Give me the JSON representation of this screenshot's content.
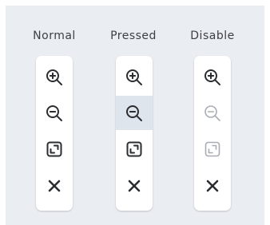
{
  "columns": [
    {
      "label": "Normal",
      "state": "normal",
      "tools": [
        {
          "name": "zoom-in",
          "icon": "zoom-in-icon",
          "pressed": false,
          "disabled": false
        },
        {
          "name": "zoom-out",
          "icon": "zoom-out-icon",
          "pressed": false,
          "disabled": false
        },
        {
          "name": "fit-to-screen",
          "icon": "fit-to-screen-icon",
          "pressed": false,
          "disabled": false
        },
        {
          "name": "close",
          "icon": "close-icon",
          "pressed": false,
          "disabled": false
        }
      ]
    },
    {
      "label": "Pressed",
      "state": "pressed",
      "tools": [
        {
          "name": "zoom-in",
          "icon": "zoom-in-icon",
          "pressed": false,
          "disabled": false
        },
        {
          "name": "zoom-out",
          "icon": "zoom-out-icon",
          "pressed": true,
          "disabled": false
        },
        {
          "name": "fit-to-screen",
          "icon": "fit-to-screen-icon",
          "pressed": false,
          "disabled": false
        },
        {
          "name": "close",
          "icon": "close-icon",
          "pressed": false,
          "disabled": false
        }
      ]
    },
    {
      "label": "Disable",
      "state": "disabled",
      "tools": [
        {
          "name": "zoom-in",
          "icon": "zoom-in-icon",
          "pressed": false,
          "disabled": false
        },
        {
          "name": "zoom-out",
          "icon": "zoom-out-icon",
          "pressed": false,
          "disabled": true
        },
        {
          "name": "fit-to-screen",
          "icon": "fit-to-screen-icon",
          "pressed": false,
          "disabled": true
        },
        {
          "name": "close",
          "icon": "close-icon",
          "pressed": false,
          "disabled": false
        }
      ]
    }
  ],
  "colors": {
    "panel_background": "#eaedf1",
    "toolbar_background": "#ffffff",
    "pressed_background": "#dfe5ec",
    "icon_normal": "#2b2d31",
    "icon_disabled": "#a9adb3",
    "label_text": "#3c3f44"
  }
}
